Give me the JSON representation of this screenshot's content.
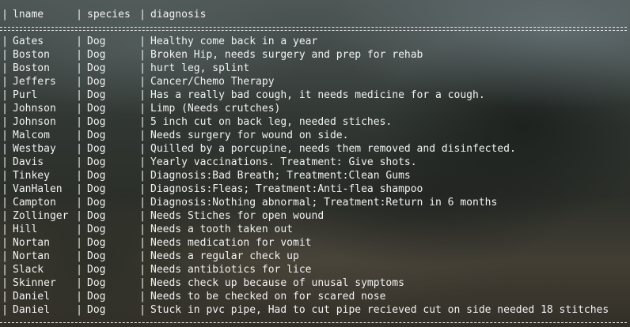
{
  "columns": [
    "lname",
    "species",
    "diagnosis"
  ],
  "rows": [
    [
      "Gates",
      "Dog",
      "Healthy come back in a year"
    ],
    [
      "Boston",
      "Dog",
      "Broken Hip, needs surgery and prep for rehab"
    ],
    [
      "Boston",
      "Dog",
      "hurt leg, splint"
    ],
    [
      "Jeffers",
      "Dog",
      "Cancer/Chemo Therapy"
    ],
    [
      "Purl",
      "Dog",
      "Has a really bad cough, it needs medicine for a cough."
    ],
    [
      "Johnson",
      "Dog",
      "Limp (Needs crutches)"
    ],
    [
      "Johnson",
      "Dog",
      "5 inch cut on back leg, needed stiches."
    ],
    [
      "Malcom",
      "Dog",
      "Needs surgery for wound on side."
    ],
    [
      "Westbay",
      "Dog",
      "Quilled by a porcupine, needs them removed and disinfected."
    ],
    [
      "Davis",
      "Dog",
      "Yearly vaccinations. Treatment: Give shots."
    ],
    [
      "Tinkey",
      "Dog",
      "Diagnosis:Bad Breath; Treatment:Clean Gums"
    ],
    [
      "VanHalen",
      "Dog",
      "Diagnosis:Fleas; Treatment:Anti-flea shampoo"
    ],
    [
      "Campton",
      "Dog",
      "Diagnosis:Nothing abnormal; Treatment:Return in 6 months"
    ],
    [
      "Zollinger",
      "Dog",
      "Needs Stiches for open wound"
    ],
    [
      "Hill",
      "Dog",
      "Needs a tooth taken out"
    ],
    [
      "Nortan",
      "Dog",
      "Needs medication for vomit"
    ],
    [
      "Nortan",
      "Dog",
      "Needs a regular check up"
    ],
    [
      "Slack",
      "Dog",
      "Needs antibiotics for lice"
    ],
    [
      "Skinner",
      "Dog",
      "Needs check up because of unusal symptoms"
    ],
    [
      "Daniel",
      "Dog",
      "Needs to be checked on for scared nose"
    ],
    [
      "Daniel",
      "Dog",
      "Stuck in pvc pipe, Had to cut pipe recieved cut on side needed 18 stitches"
    ]
  ]
}
